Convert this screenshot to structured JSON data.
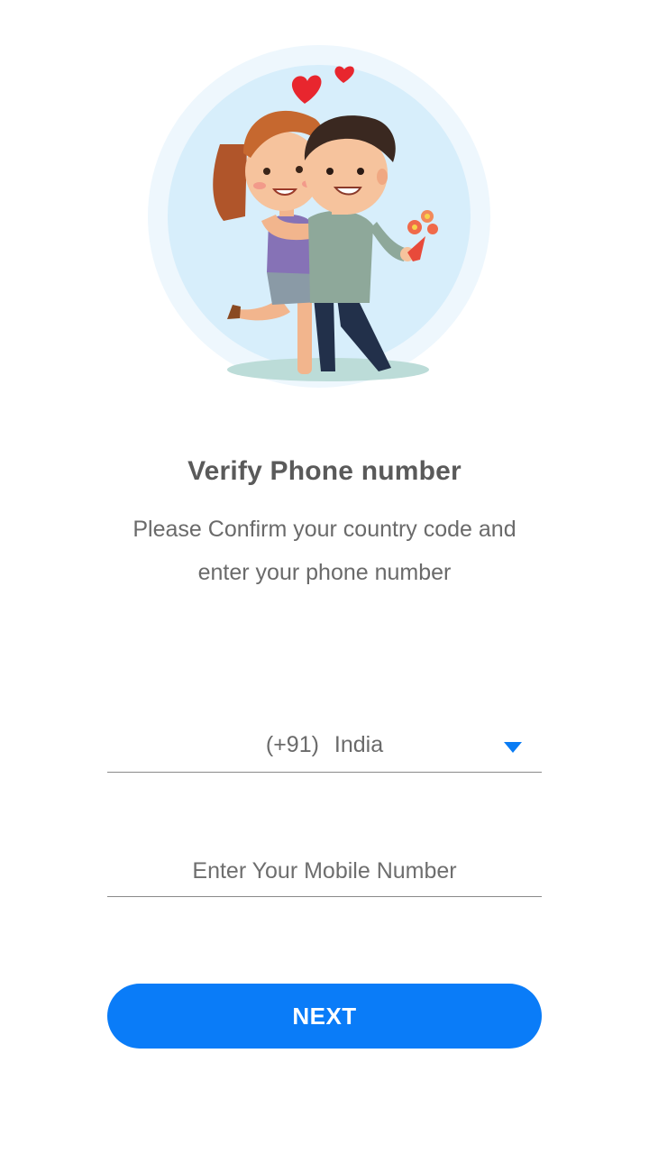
{
  "header": {
    "title": "Verify Phone number",
    "subtitle": "Please Confirm your country code and enter your phone number"
  },
  "hero": {
    "icon": "couple-illustration"
  },
  "country_selector": {
    "code": "(+91)",
    "name": "India",
    "icon": "chevron-down-icon",
    "icon_color": "#0a7cf4"
  },
  "phone": {
    "placeholder": "Enter Your Mobile Number",
    "value": ""
  },
  "actions": {
    "next_label": "NEXT",
    "accent_color": "#0a7cf8"
  }
}
